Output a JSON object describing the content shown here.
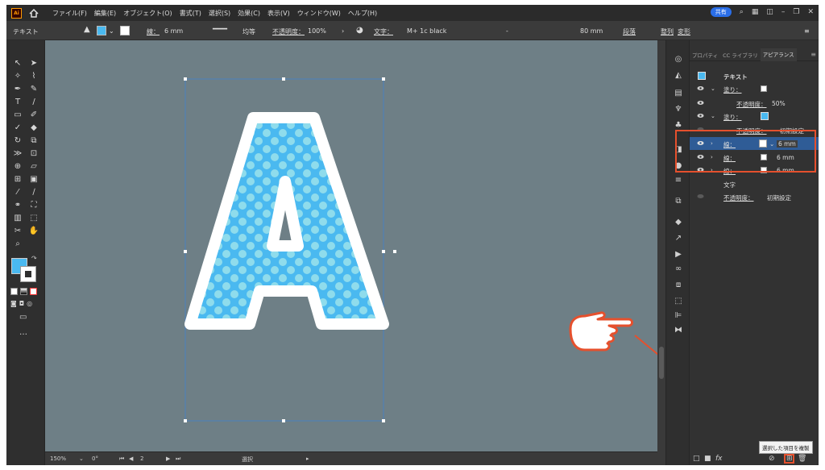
{
  "menubar": {
    "logo": "Ai",
    "items": [
      "ファイル(F)",
      "編集(E)",
      "オブジェクト(O)",
      "書式(T)",
      "選択(S)",
      "効果(C)",
      "表示(V)",
      "ウィンドウ(W)",
      "ヘルプ(H)"
    ],
    "share_label": "共有"
  },
  "controlbar": {
    "object_type": "テキスト",
    "stroke_label": "線：",
    "stroke_width": "6 mm",
    "profile_label": "均等",
    "opacity_label": "不透明度：",
    "opacity_value": "100%",
    "font_label": "文字：",
    "font_name": "M+ 1c black",
    "font_style": "-",
    "font_size": "80 mm",
    "paragraph_label": "段落",
    "align_label": "整列",
    "transform_label": "変形"
  },
  "docbar": {
    "zoom": "150%",
    "rotate": "0°",
    "artboard_num": "2",
    "status": "選択"
  },
  "panel": {
    "tabs": [
      "プロパティ",
      "CC ライブラリ",
      "アピアランス"
    ],
    "active_tab": "アピアランス",
    "title": "テキスト",
    "rows": [
      {
        "label": "塗り：",
        "value": ""
      },
      {
        "label": "不透明度：",
        "value": "50%"
      },
      {
        "label": "塗り：",
        "value": ""
      },
      {
        "label": "不透明度：",
        "value": "初期設定"
      },
      {
        "label": "線：",
        "value": "6 mm"
      },
      {
        "label": "線：",
        "value": "6 mm"
      },
      {
        "label": "線：",
        "value": "6 mm"
      },
      {
        "label": "文字",
        "value": ""
      },
      {
        "label": "不透明度：",
        "value": "初期設定"
      }
    ],
    "tooltip": "選択した項目を複製"
  },
  "colors": {
    "accent_red": "#e5502d",
    "dot_blue": "#4ab9f0",
    "dot_light": "#8fdcec",
    "canvas": "#6e7f86"
  },
  "icons": [
    "selection-tool-icon",
    "pen-tool-icon",
    "type-tool-icon",
    "hand-pointer-icon",
    "duplicate-icon",
    "trash-icon",
    "eye-icon"
  ]
}
